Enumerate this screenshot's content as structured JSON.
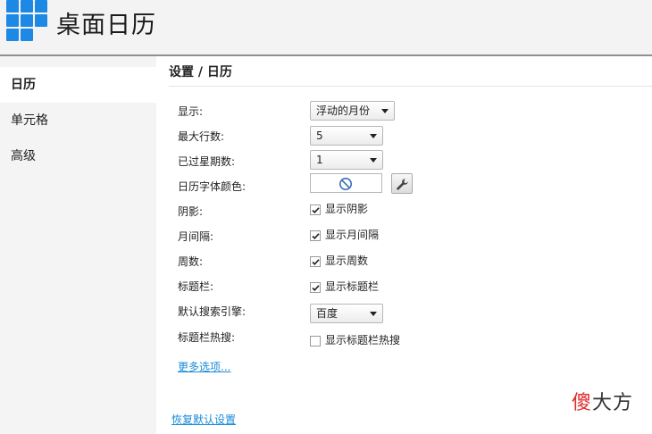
{
  "app": {
    "title": "桌面日历"
  },
  "sidebar": {
    "items": [
      {
        "label": "日历",
        "active": true
      },
      {
        "label": "单元格",
        "active": false
      },
      {
        "label": "高级",
        "active": false
      }
    ]
  },
  "content": {
    "title": "设置 / 日历",
    "rows": {
      "display": {
        "label": "显示:",
        "value": "浮动的月份"
      },
      "max_rows": {
        "label": "最大行数:",
        "value": "5"
      },
      "past_weeks": {
        "label": "已过星期数:",
        "value": "1"
      },
      "font_color": {
        "label": "日历字体颜色:"
      },
      "shadow": {
        "label": "阴影:",
        "checkbox_label": "显示阴影",
        "checked": true
      },
      "month_gap": {
        "label": "月间隔:",
        "checkbox_label": "显示月间隔",
        "checked": true
      },
      "week_num": {
        "label": "周数:",
        "checkbox_label": "显示周数",
        "checked": true
      },
      "title_bar": {
        "label": "标题栏:",
        "checkbox_label": "显示标题栏",
        "checked": true
      },
      "search_engine": {
        "label": "默认搜索引擎:",
        "value": "百度"
      },
      "title_hot": {
        "label": "标题栏热搜:",
        "checkbox_label": "显示标题栏热搜",
        "checked": false
      }
    },
    "more_options": "更多选项...",
    "restore_defaults": "恢复默认设置"
  },
  "watermark": {
    "first": "傻",
    "rest": "大方"
  },
  "colors": {
    "accent": "#1e88e5",
    "link": "#1a8bd8",
    "watermark_red": "#e02a2a"
  }
}
